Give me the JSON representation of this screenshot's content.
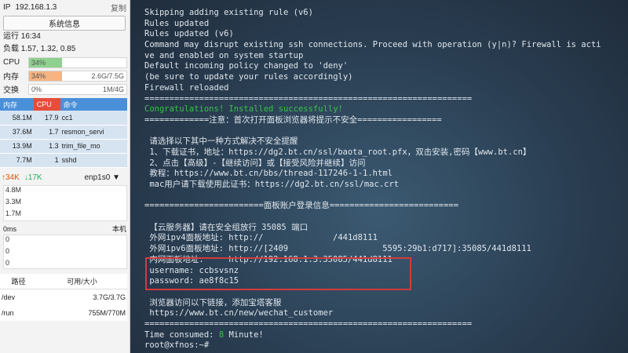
{
  "sidebar": {
    "ip_label": "IP",
    "ip_value": "192.168.1.3",
    "copy_label": "复制",
    "sysinfo_button": "系统信息",
    "uptime": "运行 16:34",
    "load": "负载 1.57, 1.32, 0.85",
    "meters": [
      {
        "label": "CPU",
        "text": "34%",
        "right": "",
        "fill": 0.34,
        "color": "#8fd18f"
      },
      {
        "label": "内存",
        "text": "34%",
        "right": "2.6G/7.5G",
        "fill": 0.34,
        "color": "#f5b482"
      },
      {
        "label": "交换",
        "text": "0%",
        "right": "1M/4G",
        "fill": 0.0,
        "color": "#8fd18f"
      }
    ],
    "proc_headers": [
      "内存",
      "CPU",
      "命令"
    ],
    "processes": [
      {
        "mem": "58.1M",
        "cpu": "17.9",
        "cmd": "cc1"
      },
      {
        "mem": "37.6M",
        "cpu": "1.7",
        "cmd": "resmon_servi"
      },
      {
        "mem": "13.9M",
        "cpu": "1.3",
        "cmd": "trim_file_mo"
      },
      {
        "mem": "7.7M",
        "cpu": "1",
        "cmd": "sshd"
      }
    ],
    "net": {
      "up": "34K",
      "down": "17K",
      "iface": "enp1s0",
      "ticks": [
        "4.8M",
        "3.3M",
        "1.7M"
      ]
    },
    "ping": {
      "label": "0ms",
      "native": "本机",
      "ticks": [
        "0",
        "0",
        "0"
      ]
    },
    "disk_headers": [
      "路径",
      "可用/大小"
    ],
    "disks": [
      {
        "path": "/dev",
        "size": "3.7G/3.7G"
      },
      {
        "path": "/run",
        "size": "755M/770M"
      }
    ]
  },
  "terminal": {
    "lines": [
      {
        "text": "Skipping adding existing rule (v6)",
        "style": ""
      },
      {
        "text": "Rules updated",
        "style": ""
      },
      {
        "text": "Rules updated (v6)",
        "style": ""
      },
      {
        "text": "Command may disrupt existing ssh connections. Proceed with operation (y|n)? Firewall is acti",
        "style": ""
      },
      {
        "text": "ve and enabled on system startup",
        "style": ""
      },
      {
        "text": "Default incoming policy changed to 'deny'",
        "style": ""
      },
      {
        "text": "(be sure to update your rules accordingly)",
        "style": ""
      },
      {
        "text": "Firewall reloaded",
        "style": ""
      },
      {
        "text": "==================================================================",
        "style": ""
      },
      {
        "text": "Congratulations! Installed successfully!",
        "style": "green"
      },
      {
        "text": "=============注意：首次打开面板浏览器将提示不安全=================",
        "style": ""
      },
      {
        "text": "",
        "style": "gap"
      },
      {
        "text": " 请选择以下其中一种方式解决不安全提醒",
        "style": ""
      },
      {
        "text": " 1、下载证书，地址：https://dg2.bt.cn/ssl/baota_root.pfx，双击安装,密码【www.bt.cn】",
        "style": ""
      },
      {
        "text": " 2、点击【高级】-【继续访问】或【接受风险并继续】访问",
        "style": ""
      },
      {
        "text": " 教程：https://www.bt.cn/bbs/thread-117246-1-1.html",
        "style": ""
      },
      {
        "text": " mac用户请下载使用此证书：https://dg2.bt.cn/ssl/mac.crt",
        "style": ""
      },
      {
        "text": "",
        "style": "gap"
      },
      {
        "text": "========================面板账户登录信息==========================",
        "style": ""
      },
      {
        "text": "",
        "style": "gap"
      },
      {
        "text": " 【云服务器】请在安全组放行 35085 端口",
        "style": ""
      },
      {
        "text": " 外网ipv4面板地址: http://              /441d8111",
        "style": ""
      },
      {
        "text": " 外网ipv6面板地址: http://[2409                   5595:29b1:d717]:35085/441d8111",
        "style": ""
      },
      {
        "text": " 内网面板地址:     http://192.168.1.3:35085/441d8111",
        "style": ""
      },
      {
        "text": " username: ccbsvsnz",
        "style": ""
      },
      {
        "text": " password: ae8f8c15",
        "style": ""
      },
      {
        "text": "",
        "style": "gap"
      },
      {
        "text": " 浏览器访问以下链接，添加宝塔客服",
        "style": ""
      },
      {
        "text": " https://www.bt.cn/new/wechat_customer",
        "style": ""
      },
      {
        "text": "==================================================================",
        "style": ""
      },
      {
        "text": "Time consumed: 8 Minute!",
        "style": "time"
      },
      {
        "text": "root@xfnos:~#",
        "style": ""
      }
    ]
  },
  "colors": {
    "highlight_border": "#d23b3b",
    "success_green": "#39c24a",
    "header_blue": "#4a90d9",
    "header_red": "#e74c3c"
  }
}
